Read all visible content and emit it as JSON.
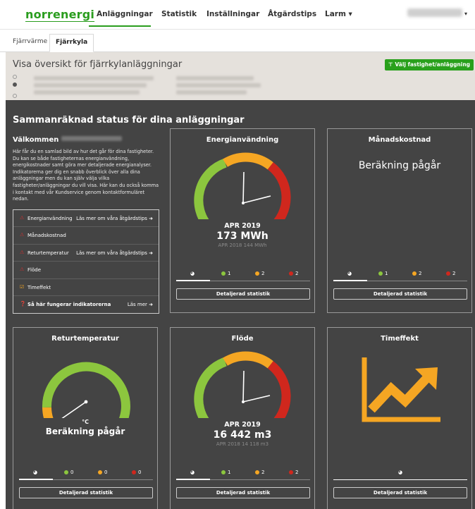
{
  "nav": {
    "logo": "norrenergi",
    "items": [
      "Anläggningar",
      "Statistik",
      "Inställningar",
      "Åtgärdstips",
      "Larm ▾"
    ],
    "user_caret": "▾"
  },
  "subtabs": [
    "Fjärrvärme",
    "Fjärrkyla"
  ],
  "overview": {
    "title": "Visa översikt för fjärrkylanläggningar",
    "button": "Välj fastighet/anläggning"
  },
  "dashboard": {
    "title": "Sammanräknad status för dina anläggningar",
    "welcome_title": "Välkommen",
    "welcome_text": "Här får du en samlad bild av hur det går för dina fastigheter. Du kan se både fastigheternas energianvändning, energikostnader samt göra mer detaljerade energianalyser. Indikatorerna ger dig en snabb överblick över alla dina anläggningar men du kan själv välja vilka fastigheter/anläggningar du vill visa. Här kan du också komma i kontakt med vår Kundservice genom kontaktformuläret nedan.",
    "indicators": [
      {
        "label": "Energianvändning",
        "more": "Läs mer om våra åtgärdstips ➜",
        "icon": "warning-icon"
      },
      {
        "label": "Månadskostnad",
        "more": "",
        "icon": "warning-icon"
      },
      {
        "label": "Returtemperatur",
        "more": "Läs mer om våra åtgärdstips ➜",
        "icon": "warning-icon"
      },
      {
        "label": "Flöde",
        "more": "",
        "icon": "warning-icon"
      },
      {
        "label": "Timeffekt",
        "more": "",
        "icon": "check-icon"
      },
      {
        "label": "Så här fungerar indikatorerna",
        "more": "Läs mer ➜",
        "icon": "help-icon"
      }
    ]
  },
  "cards": {
    "energy": {
      "title": "Energianvändning",
      "month": "APR 2019",
      "value": "173 MWh",
      "prev": "APR 2018 144 MWh",
      "legend": [
        "1",
        "2",
        "2"
      ],
      "button": "Detaljerad statistik"
    },
    "cost": {
      "title": "Månadskostnad",
      "status": "Beräkning pågår",
      "legend": [
        "1",
        "2",
        "2"
      ],
      "button": "Detaljerad statistik"
    },
    "return_temp": {
      "title": "Returtemperatur",
      "unit": "°C",
      "status": "Beräkning pågår",
      "legend": [
        "0",
        "0",
        "0"
      ],
      "button": "Detaljerad statistik"
    },
    "flow": {
      "title": "Flöde",
      "month": "APR 2019",
      "value": "16 442 m3",
      "prev": "APR 2018 14 118 m3",
      "legend": [
        "1",
        "2",
        "2"
      ],
      "button": "Detaljerad statistik"
    },
    "power": {
      "title": "Timeffekt",
      "button": "Detaljerad statistik"
    }
  },
  "colors": {
    "green": "#8cc63e",
    "orange": "#f5a623",
    "red": "#d0271d",
    "brand": "#2a9d1e"
  }
}
